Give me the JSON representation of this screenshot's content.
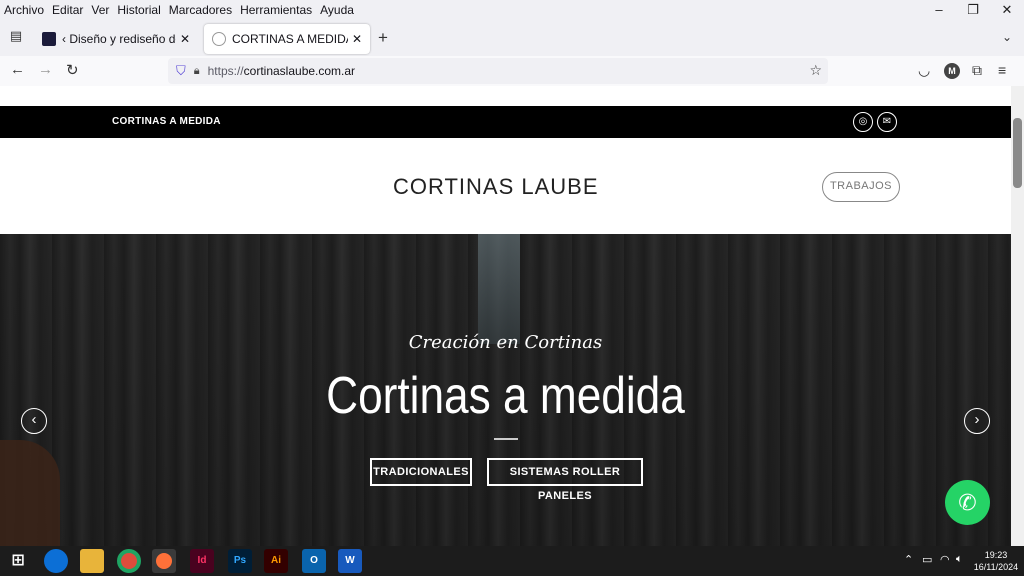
{
  "menubar": {
    "items": [
      "Archivo",
      "Editar",
      "Ver",
      "Historial",
      "Marcadores",
      "Herramientas",
      "Ayuda"
    ]
  },
  "window_controls": {
    "minimize": "–",
    "restore": "❐",
    "close": "✕"
  },
  "tabs": [
    {
      "label": "‹ Diseño y rediseño de páginas",
      "close": "✕"
    },
    {
      "label": "CORTINAS A MEDIDA – Instala",
      "close": "✕"
    }
  ],
  "newtab": "+",
  "nav": {
    "back": "←",
    "forward": "→",
    "reload": "↻",
    "url": "https://cortinaslaube.com.ar",
    "url_prefix": "https://",
    "url_host": "cortinaslaube.com.ar",
    "account_initial": "M"
  },
  "site": {
    "topbar_brand": "CORTINAS A MEDIDA",
    "logo": "CORTINAS LAUBE",
    "nav_button": "TRABAJOS",
    "hero": {
      "subtitle": "Creación en Cortinas",
      "title": "Cortinas a medida",
      "buttons": [
        "TRADICIONALES",
        "SISTEMAS ROLLER PANELES"
      ]
    }
  },
  "taskbar": {
    "apps": [
      "edge-icon",
      "file-explorer-icon",
      "chrome-icon",
      "firefox-icon",
      "indesign-icon",
      "photoshop-icon",
      "illustrator-icon",
      "outlook-icon",
      "word-icon"
    ],
    "labels": {
      "indesign": "Id",
      "photoshop": "Ps",
      "illustrator": "Ai",
      "outlook": "O",
      "word": "W"
    },
    "time": "19:23",
    "date": "16/11/2024"
  },
  "colors": {
    "whatsapp": "#25d366",
    "topbar": "#000000",
    "accent_purple": "#5a49d6"
  }
}
